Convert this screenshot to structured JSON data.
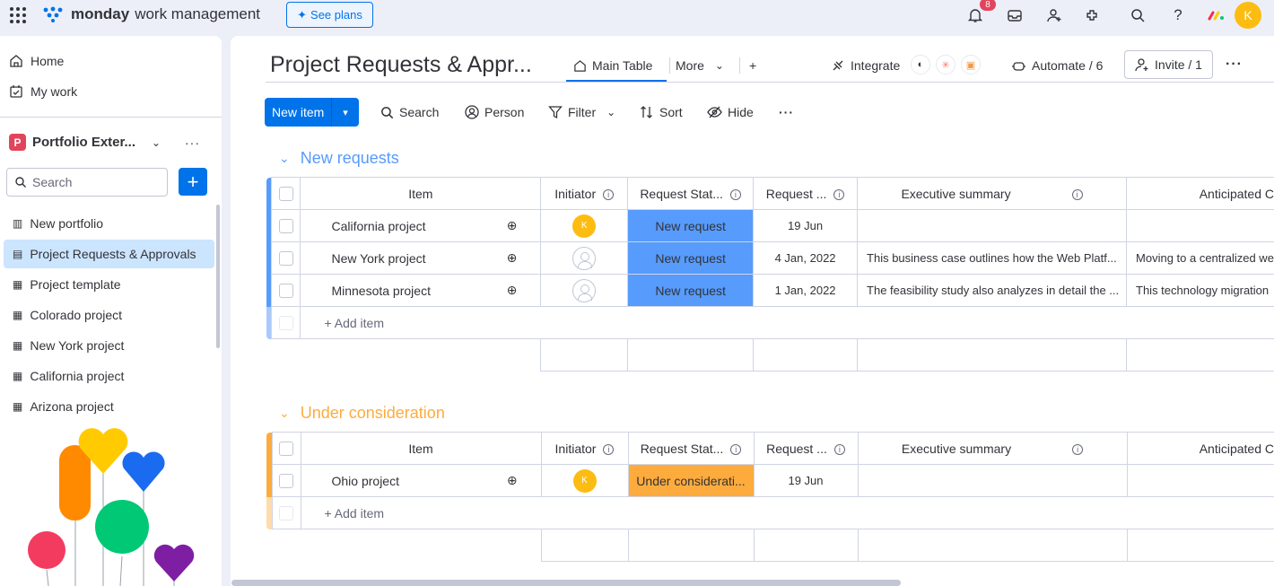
{
  "topbar": {
    "brand": "monday",
    "product": "work management",
    "see_plans": "See plans",
    "notif_count": "8",
    "avatar_initial": "K"
  },
  "sidebar": {
    "home": "Home",
    "my_work": "My work",
    "workspace_badge": "P",
    "workspace_name": "Portfolio Exter...",
    "search_placeholder": "Search",
    "boards": [
      "New portfolio",
      "Project Requests & Approvals",
      "Project template",
      "Colorado project",
      "New York project",
      "California project",
      "Arizona project"
    ]
  },
  "board": {
    "title": "Project Requests & Appr...",
    "tabs": {
      "main": "Main Table",
      "more": "More",
      "add": "+"
    },
    "integrate": "Integrate",
    "automate": "Automate / 6",
    "invite": "Invite / 1",
    "toolbar": {
      "new_item": "New item",
      "search": "Search",
      "person": "Person",
      "filter": "Filter",
      "sort": "Sort",
      "hide": "Hide"
    },
    "columns": [
      "Item",
      "Initiator",
      "Request Stat...",
      "Request ...",
      "Executive summary",
      "Anticipated C"
    ],
    "add_item": "+ Add item",
    "groups": [
      {
        "title": "New requests",
        "color": "#579bfc",
        "rows": [
          {
            "item": "California project",
            "initiator": "K",
            "status": "New request",
            "date": "19 Jun",
            "summary": "",
            "anticipated": ""
          },
          {
            "item": "New York project",
            "initiator": "",
            "status": "New request",
            "date": "4 Jan, 2022",
            "summary": "This business case outlines how the Web Platf...",
            "anticipated": "Moving to a centralized we"
          },
          {
            "item": "Minnesota project",
            "initiator": "",
            "status": "New request",
            "date": "1 Jan, 2022",
            "summary": "The feasibility study also analyzes in detail the ...",
            "anticipated": "This technology migration"
          }
        ]
      },
      {
        "title": "Under consideration",
        "color": "#fdab3d",
        "rows": [
          {
            "item": "Ohio project",
            "initiator": "K",
            "status": "Under considerati...",
            "date": "19 Jun",
            "summary": "",
            "anticipated": ""
          }
        ]
      }
    ]
  }
}
